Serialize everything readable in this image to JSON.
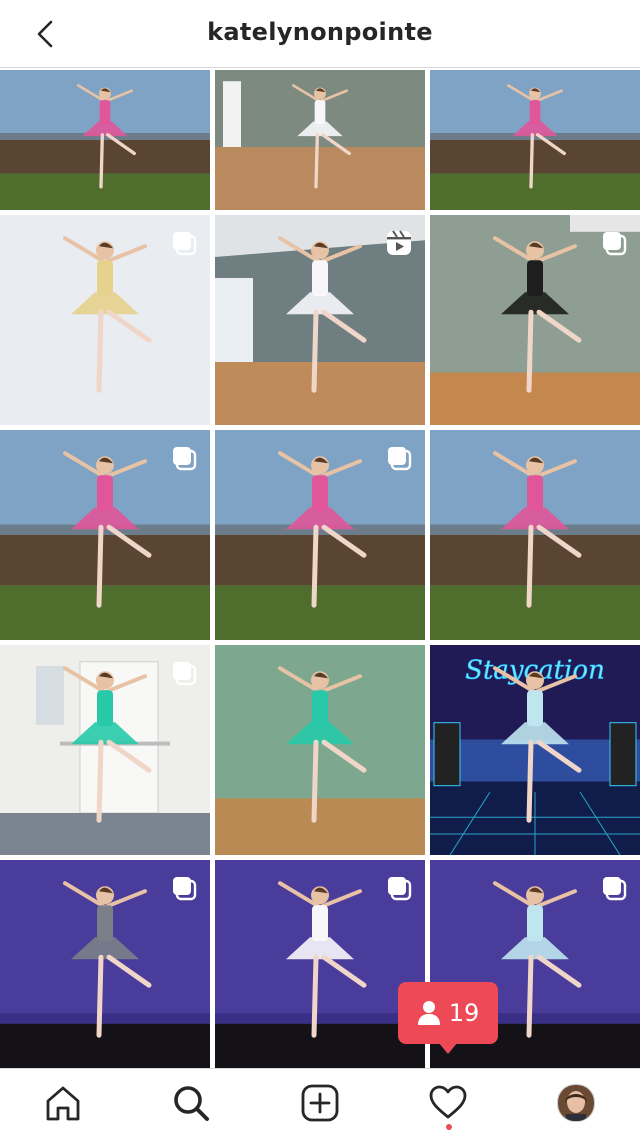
{
  "header": {
    "title": "katelynonpointe",
    "back_icon": "chevron-left-icon"
  },
  "grid": {
    "posts": [
      {
        "scene": "outdoor",
        "dress": "pink",
        "badge": "none"
      },
      {
        "scene": "studio-gray",
        "dress": "white",
        "badge": "none"
      },
      {
        "scene": "outdoor",
        "dress": "pink",
        "badge": "none"
      },
      {
        "scene": "studio-white",
        "dress": "yellow",
        "badge": "multiple-posts-icon"
      },
      {
        "scene": "studio-room",
        "dress": "white",
        "badge": "reels-icon"
      },
      {
        "scene": "studio-green",
        "dress": "black",
        "badge": "multiple-posts-icon"
      },
      {
        "scene": "outdoor",
        "dress": "pink",
        "badge": "multiple-posts-icon"
      },
      {
        "scene": "outdoor",
        "dress": "pink",
        "badge": "multiple-posts-icon"
      },
      {
        "scene": "outdoor",
        "dress": "pink",
        "badge": "none"
      },
      {
        "scene": "room-white",
        "dress": "teal",
        "badge": "multiple-posts-icon"
      },
      {
        "scene": "studio-mint",
        "dress": "teal",
        "badge": "none"
      },
      {
        "scene": "neon",
        "dress": "lightblue",
        "badge": "none",
        "sign": "Staycation"
      },
      {
        "scene": "stage",
        "dress": "gray",
        "badge": "multiple-posts-icon"
      },
      {
        "scene": "stage",
        "dress": "white",
        "badge": "multiple-posts-icon"
      },
      {
        "scene": "stage",
        "dress": "lightblue",
        "badge": "multiple-posts-icon"
      }
    ]
  },
  "notification": {
    "icon": "person-icon",
    "count": "19",
    "color": "#ed4956"
  },
  "tabbar": {
    "items": [
      {
        "name": "home-icon"
      },
      {
        "name": "search-icon"
      },
      {
        "name": "new-post-icon"
      },
      {
        "name": "heart-icon"
      },
      {
        "name": "profile-avatar"
      }
    ]
  }
}
